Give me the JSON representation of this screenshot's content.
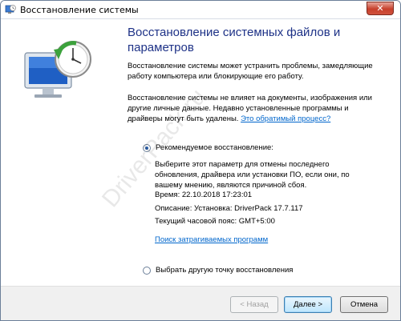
{
  "window": {
    "title": "Восстановление системы",
    "close_label": "✕"
  },
  "main": {
    "heading": "Восстановление системных файлов и параметров",
    "para1": "Восстановление системы может устранить проблемы, замедляющие работу компьютера или блокирующие его работу.",
    "para2": "Восстановление системы не влияет на документы, изображения или другие личные данные. Недавно установленные программы и драйверы могут быть удалены.",
    "para2_link": "Это обратимый процесс?",
    "recommended": {
      "label": "Рекомендуемое восстановление:",
      "checked": true,
      "description": "Выберите этот параметр для отмены последнего обновления, драйвера или установки ПО, если они, по вашему мнению, являются причиной сбоя.",
      "time": "Время: 22.10.2018 17:23:01",
      "desc_line": "Описание: Установка: DriverPack 17.7.117",
      "timezone": "Текущий часовой пояс: GMT+5:00",
      "affected_link": "Поиск затрагиваемых программ"
    },
    "other": {
      "label": "Выбрать другую точку восстановления",
      "checked": false
    },
    "watermark": "DriverPack.ru"
  },
  "footer": {
    "back_label": "< Назад",
    "next_label": "Далее >",
    "cancel_label": "Отмена"
  }
}
